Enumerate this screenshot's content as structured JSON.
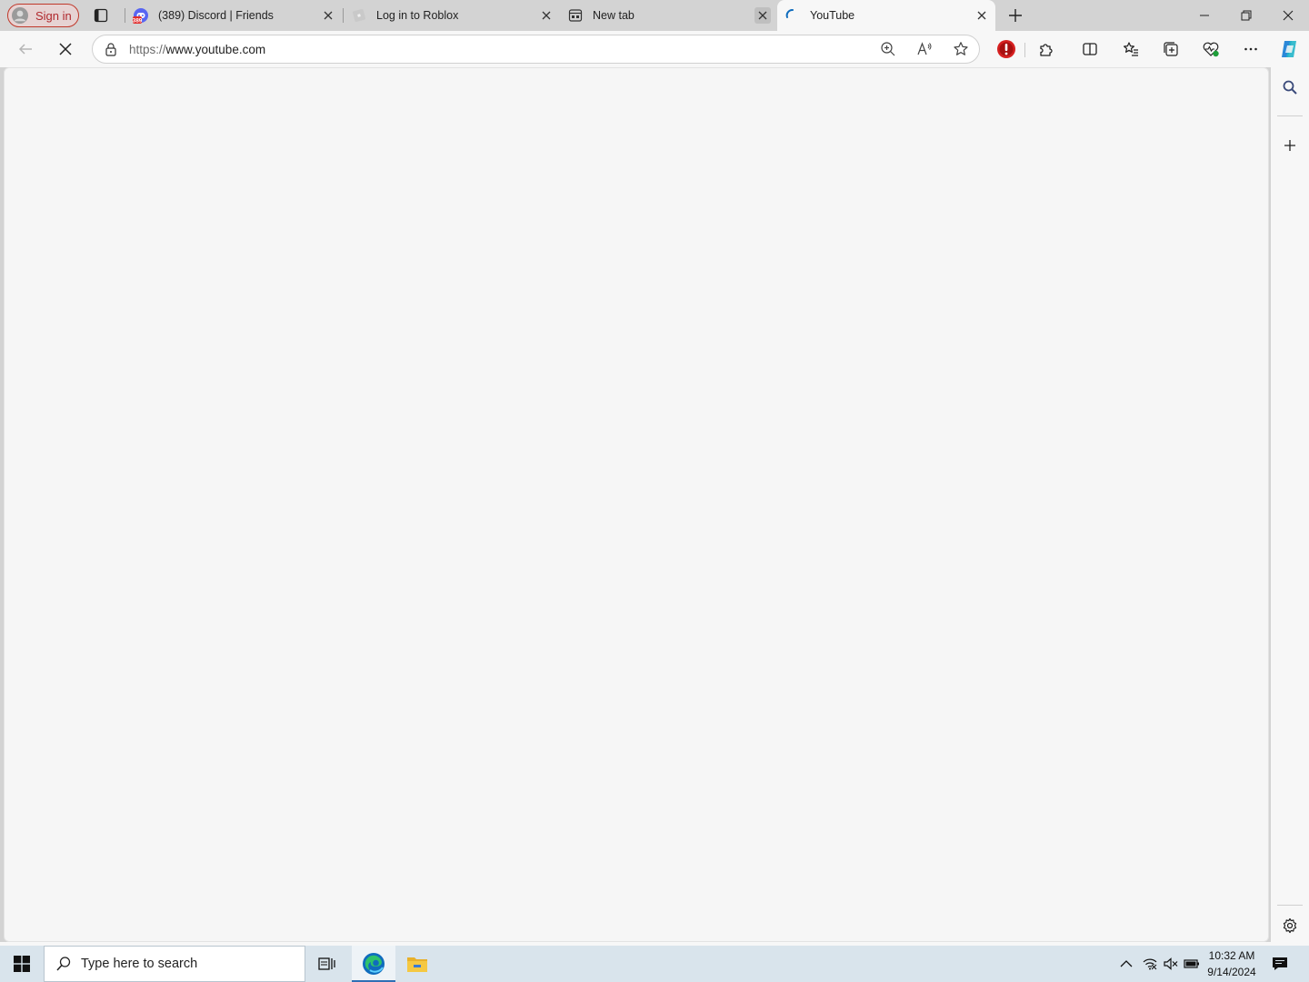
{
  "profile": {
    "signin_label": "Sign in"
  },
  "tabs": [
    {
      "title": "(389) Discord | Friends",
      "badge": "389",
      "favicon": "discord-icon"
    },
    {
      "title": "Log in to Roblox",
      "favicon": "roblox-icon"
    },
    {
      "title": "New tab",
      "favicon": "new-tab-icon"
    },
    {
      "title": "YouTube",
      "favicon": "loading-spinner-icon",
      "active": true
    }
  ],
  "address_bar": {
    "url_scheme": "https://",
    "url_host": "www.youtube.com"
  },
  "taskbar": {
    "search_placeholder": "Type here to search",
    "time": "10:32 AM",
    "date": "9/14/2024"
  },
  "colors": {
    "signin_red": "#b0282d",
    "discord_blurple": "#5865f2",
    "edge_blue": "#0f6cbd",
    "taskbar_bg": "#d9e4ec"
  }
}
